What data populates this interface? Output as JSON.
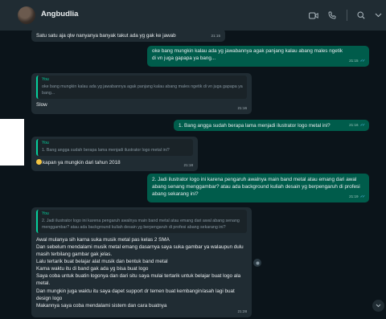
{
  "header": {
    "contact_name": "Angbudlia"
  },
  "messages": [
    {
      "id": "m1",
      "direction": "in",
      "text": "Satu satu aja qlw nanyanya banyak takut ada yg gak ke jawab",
      "time": "21:15"
    },
    {
      "id": "m2",
      "direction": "out",
      "text": "oke bang mungkin kalau ada yg jawabannya agak panjang kalau abang males ngetik di vn juga gapapa ya bang...",
      "time": "21:15"
    },
    {
      "id": "m3",
      "direction": "in",
      "quote_name": "You",
      "quote_text": "oke bang mungkin kalau ada yg jawabannya agak panjang kalau abang males ngetik di vn juga gapapa ya bang...",
      "text": "Slow",
      "time": "21:16"
    },
    {
      "id": "m4",
      "direction": "out",
      "text": "1. Bang angga sudah berapa lama menjadi ilustrator logo metal ini?",
      "time": "21:16"
    },
    {
      "id": "m5",
      "direction": "in",
      "quote_name": "You",
      "quote_text": "1. Bang angga sudah berapa lama menjadi ilustrator logo metal ini?",
      "text": "kapan ya mungkin dari tahun 2018",
      "time": "21:18"
    },
    {
      "id": "m6",
      "direction": "out",
      "text": "2. Jadi ilustrator logo ini karena pengaruh awalnya main band metal atau emang dari awal abang senang menggambar? atau ada background kuliah desain yg berpengaruh di profesi abang sekarang ini?",
      "time": "21:19"
    },
    {
      "id": "m7",
      "direction": "in",
      "quote_name": "You",
      "quote_text": "2. Jadi ilustrator logo ini karena pengaruh awalnya main band metal atau emang dari awal abang senang menggambar? atau ada background kuliah desain yg berpengaruh di profesi abang sekarang ini?",
      "text": "Awal mulanya sih karna suka musik metal pas kelas 2 SMA\nDan sebelum mendalami musik metal emang dasarnya saya suka gambar ya walaupun dulu masih terbilang gambar gak jelas.\nLalu tertarik buat belajar alat musik dan bentuk band metal\nKarna waktu itu di band gak ada yg bisa buat logo\nSaya coba untuk buatin logonya dan dari situ saya mulai tertarik untuk belajar buat logo ala metal.\nDan mungkin juga waktu itu saya dapet support dr temen buat kembangin/asah lagi buat design logo\nMakannya saya coba mendalami sistem dan cara buatnya",
      "time": "21:28"
    }
  ],
  "colors": {
    "header_bg": "#202c33",
    "chat_bg": "#0b141a",
    "incoming_bubble": "#202c33",
    "outgoing_bubble": "#005c4b",
    "quote_accent": "#06cf9c",
    "read_check": "#53bdeb"
  },
  "icons": [
    "video-call-icon",
    "voice-call-icon",
    "search-icon",
    "chevron-down-icon",
    "double-check-icon",
    "emoji-icon",
    "scroll-down-icon",
    "reaction-icon"
  ]
}
